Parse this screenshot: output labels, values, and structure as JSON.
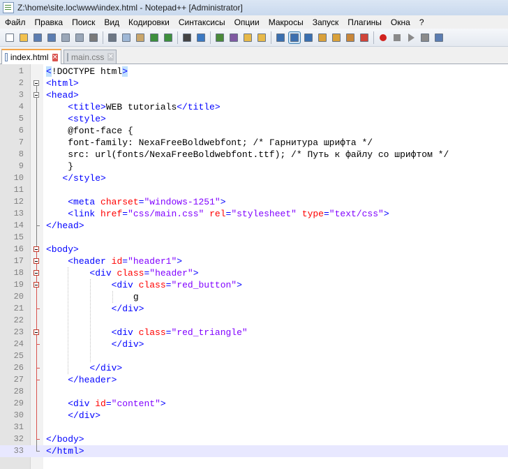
{
  "window": {
    "title": "Z:\\home\\site.loc\\www\\index.html - Notepad++ [Administrator]"
  },
  "menu": [
    "Файл",
    "Правка",
    "Поиск",
    "Вид",
    "Кодировки",
    "Синтаксисы",
    "Опции",
    "Макросы",
    "Запуск",
    "Плагины",
    "Окна",
    "?"
  ],
  "tabs": [
    {
      "label": "index.html",
      "active": true
    },
    {
      "label": "main.css",
      "active": false
    }
  ],
  "editor": {
    "lines": [
      {
        "n": "1",
        "html": "<span class='bracket-hl'>&lt;</span><span class='doctype'>!DOCTYPE html</span><span class='bracket-hl'>&gt;</span>"
      },
      {
        "n": "2",
        "html": "<span class='tag'>&lt;html&gt;</span>"
      },
      {
        "n": "3",
        "html": "<span class='tag'>&lt;head&gt;</span>"
      },
      {
        "n": "4",
        "html": "    <span class='tag'>&lt;title&gt;</span>WEB tutorials<span class='tag'>&lt;/title&gt;</span>"
      },
      {
        "n": "5",
        "html": "    <span class='tag'>&lt;style&gt;</span>"
      },
      {
        "n": "6",
        "html": "    @font-face {"
      },
      {
        "n": "7",
        "html": "    font-family: NexaFreeBoldwebfont; /* Гарнитура шрифта */"
      },
      {
        "n": "8",
        "html": "    src: url(fonts/NexaFreeBoldwebfont.ttf); /* Путь к файлу со шрифтом */"
      },
      {
        "n": "9",
        "html": "    }"
      },
      {
        "n": "10",
        "html": "   <span class='tag'>&lt;/style&gt;</span>"
      },
      {
        "n": "11",
        "html": ""
      },
      {
        "n": "12",
        "html": "    <span class='tag'>&lt;meta</span> <span class='attr'>charset</span><span class='tag'>=</span><span class='val'>\"windows-1251\"</span><span class='tag'>&gt;</span>"
      },
      {
        "n": "13",
        "html": "    <span class='tag'>&lt;link</span> <span class='attr'>href</span><span class='tag'>=</span><span class='val'>\"css/main.css\"</span> <span class='attr'>rel</span><span class='tag'>=</span><span class='val'>\"stylesheet\"</span> <span class='attr'>type</span><span class='tag'>=</span><span class='val'>\"text/css\"</span><span class='tag'>&gt;</span>"
      },
      {
        "n": "14",
        "html": "<span class='tag'>&lt;/head&gt;</span>"
      },
      {
        "n": "15",
        "html": ""
      },
      {
        "n": "16",
        "html": "<span class='tag'>&lt;body&gt;</span>"
      },
      {
        "n": "17",
        "html": "    <span class='tag'>&lt;header</span> <span class='attr'>id</span><span class='tag'>=</span><span class='val'>\"header1\"</span><span class='tag'>&gt;</span>"
      },
      {
        "n": "18",
        "html": "        <span class='tag'>&lt;div</span> <span class='attr'>class</span><span class='tag'>=</span><span class='val'>\"header\"</span><span class='tag'>&gt;</span>"
      },
      {
        "n": "19",
        "html": "            <span class='tag'>&lt;div</span> <span class='attr'>class</span><span class='tag'>=</span><span class='val'>\"red_button\"</span><span class='tag'>&gt;</span>"
      },
      {
        "n": "20",
        "html": "                g"
      },
      {
        "n": "21",
        "html": "            <span class='tag'>&lt;/div&gt;</span>"
      },
      {
        "n": "22",
        "html": ""
      },
      {
        "n": "23",
        "html": "            <span class='tag'>&lt;div</span> <span class='attr'>class</span><span class='tag'>=</span><span class='val'>\"red_triangle\"</span>"
      },
      {
        "n": "24",
        "html": "            <span class='tag'>&lt;/div&gt;</span>"
      },
      {
        "n": "25",
        "html": ""
      },
      {
        "n": "26",
        "html": "        <span class='tag'>&lt;/div&gt;</span>"
      },
      {
        "n": "27",
        "html": "    <span class='tag'>&lt;/header&gt;</span>"
      },
      {
        "n": "28",
        "html": ""
      },
      {
        "n": "29",
        "html": "    <span class='tag'>&lt;div</span> <span class='attr'>id</span><span class='tag'>=</span><span class='val'>\"content\"</span><span class='tag'>&gt;</span>"
      },
      {
        "n": "30",
        "html": "    <span class='tag'>&lt;/div&gt;</span>"
      },
      {
        "n": "31",
        "html": ""
      },
      {
        "n": "32",
        "html": "<span class='tag'>&lt;/body&gt;</span>"
      },
      {
        "n": "33",
        "html": "<span class='tag'>&lt;/html&gt;</span>"
      }
    ],
    "current_line": "33"
  },
  "colors": {
    "tag": "#0000ff",
    "attribute": "#ff0000",
    "value": "#8000ff",
    "active_tab_accent": "#f3a44a",
    "close_button": "#d9534f"
  },
  "toolbar_icons": [
    "new-file-icon",
    "open-file-icon",
    "save-icon",
    "save-all-icon",
    "close-icon",
    "close-all-icon",
    "print-icon",
    "cut-icon",
    "copy-icon",
    "paste-icon",
    "undo-icon",
    "redo-icon",
    "find-icon",
    "replace-icon",
    "zoom-in-icon",
    "zoom-out-icon",
    "sync-v-icon",
    "sync-h-icon",
    "word-wrap-icon",
    "show-all-chars-icon",
    "indent-guide-icon",
    "udl-icon",
    "doc-map-icon",
    "function-list-icon",
    "folder-workspace-icon",
    "record-macro-icon",
    "stop-record-icon",
    "play-macro-icon",
    "run-macro-multiple-icon",
    "save-macro-icon"
  ]
}
